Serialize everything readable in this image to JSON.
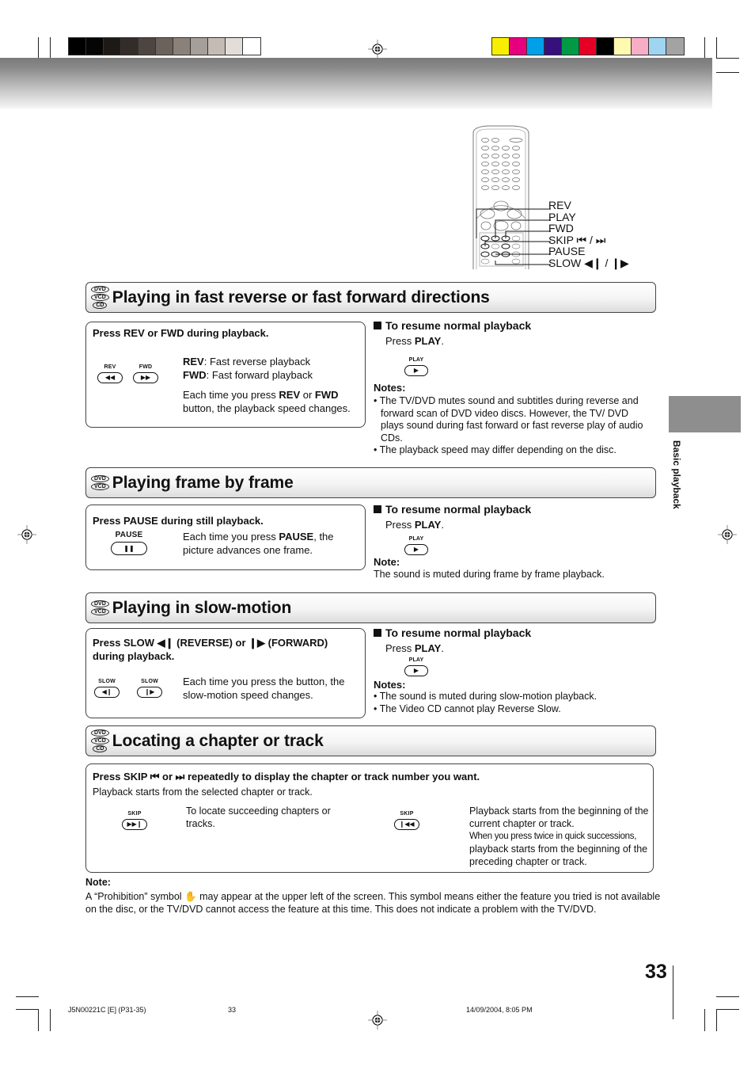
{
  "print_marks": {
    "gray_swatches": [
      "#000000",
      "#050505",
      "#1d1917",
      "#332c29",
      "#4d4540",
      "#6b625b",
      "#8a817a",
      "#a69e98",
      "#c4bbb5",
      "#e2ddd9",
      "#ffffff"
    ],
    "color_swatches": [
      "#f8ef00",
      "#e6007e",
      "#00a0e9",
      "#36117c",
      "#009a44",
      "#e60026",
      "#000000",
      "#fff9b1",
      "#f6adc6",
      "#9fd5f2",
      "#a3a3a3"
    ]
  },
  "remote": {
    "labels": [
      "REV",
      "PLAY",
      "FWD",
      "SKIP ⏮ / ⏭",
      "PAUSE",
      "SLOW ◀❙ / ❙▶"
    ]
  },
  "side_tab": {
    "label": "Basic playback"
  },
  "sections": [
    {
      "discs": [
        "DVD",
        "VCD",
        "CD"
      ],
      "title": "Playing in fast reverse or fast forward directions",
      "box": {
        "heading": "Press REV or FWD during playback.",
        "buttons": [
          {
            "label": "REV",
            "glyph": "◀◀"
          },
          {
            "label": "FWD",
            "glyph": "▶▶"
          }
        ],
        "lines": [
          {
            "bold": "REV",
            "text": ":  Fast reverse playback"
          },
          {
            "bold": "FWD",
            "text": ": Fast forward playback"
          }
        ],
        "para_pre": "Each time you press ",
        "para_b1": "REV",
        "para_mid": " or ",
        "para_b2": "FWD",
        "para_post": " button, the playback speed changes."
      },
      "resume": {
        "heading": "To resume normal playback",
        "press_pre": "Press ",
        "press_bold": "PLAY",
        "press_post": ".",
        "button_label": "PLAY",
        "button_glyph": "▶"
      },
      "notes_heading": "Notes:",
      "notes": [
        "• The TV/DVD mutes sound and subtitles during reverse and forward scan of DVD video discs. However, the TV/ DVD plays sound during fast forward or fast reverse play of audio CDs.",
        "• The playback speed may differ depending on the disc."
      ]
    },
    {
      "discs": [
        "DVD",
        "VCD"
      ],
      "title": "Playing frame by frame",
      "box": {
        "heading": "Press PAUSE during still playback.",
        "button": {
          "label": "PAUSE",
          "glyph": "❚❚"
        },
        "para_pre": "Each time you press ",
        "para_bold": "PAUSE",
        "para_post": ", the picture advances one frame."
      },
      "resume": {
        "heading": "To resume normal playback",
        "press_pre": "Press ",
        "press_bold": "PLAY",
        "press_post": ".",
        "button_label": "PLAY",
        "button_glyph": "▶"
      },
      "notes_heading": "Note:",
      "notes": [
        "The sound is muted during frame by frame playback."
      ]
    },
    {
      "discs": [
        "DVD",
        "VCD"
      ],
      "title": "Playing in slow-motion",
      "box": {
        "heading": "Press SLOW ◀❙ (REVERSE) or ❙▶ (FORWARD) during playback.",
        "buttons": [
          {
            "label": "SLOW",
            "glyph": "◀❙"
          },
          {
            "label": "SLOW",
            "glyph": "❙▶"
          }
        ],
        "para": "Each time you press the button, the slow-motion speed changes."
      },
      "resume": {
        "heading": "To resume normal playback",
        "press_pre": "Press ",
        "press_bold": "PLAY",
        "press_post": ".",
        "button_label": "PLAY",
        "button_glyph": "▶"
      },
      "notes_heading": "Notes:",
      "notes": [
        "• The sound is muted during slow-motion playback.",
        "• The Video CD cannot play Reverse Slow."
      ]
    },
    {
      "discs": [
        "DVD",
        "VCD",
        "CD"
      ],
      "title": "Locating a chapter or track",
      "box": {
        "heading": "Press SKIP ⏮ or ⏭ repeatedly to display the chapter or track number you want.",
        "subheading": "Playback starts from the selected chapter or track.",
        "items": [
          {
            "label": "SKIP",
            "glyph": "▶▶❙",
            "text": "To locate succeeding chapters or tracks."
          },
          {
            "label": "SKIP",
            "glyph": "❙◀◀",
            "text": "Playback starts from the beginning of the current chapter or track.",
            "extra": "When you press twice in quick successions,",
            "extra2": "playback starts from the beginning of the preceding chapter or track."
          }
        ]
      }
    }
  ],
  "footer_note": {
    "heading": "Note:",
    "text_pre": "A “Prohibition” symbol ",
    "symbol": "✋",
    "text_post": " may appear at the upper left of the screen. This symbol means either the feature you tried is not available on the disc, or the TV/DVD cannot access the feature at this time. This does not indicate a problem with the TV/DVD."
  },
  "page_number": "33",
  "slug": {
    "job": "J5N00221C [E] (P31-35)",
    "page": "33",
    "date": "14/09/2004, 8:05 PM"
  }
}
